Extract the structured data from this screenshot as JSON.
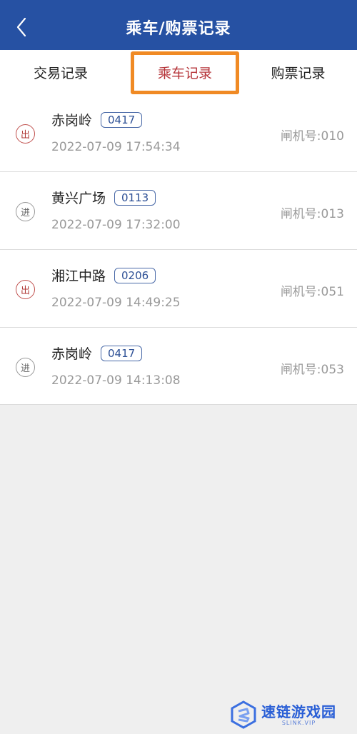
{
  "header": {
    "title": "乘车/购票记录",
    "back_icon": "chevron-left-icon"
  },
  "tabs": [
    {
      "label": "交易记录",
      "active": false
    },
    {
      "label": "乘车记录",
      "active": true
    },
    {
      "label": "购票记录",
      "active": false
    }
  ],
  "records": [
    {
      "direction": "出",
      "type": "exit",
      "station": "赤岗岭",
      "code": "0417",
      "time": "2022-07-09 17:54:34",
      "gate": "闸机号:010"
    },
    {
      "direction": "进",
      "type": "entry",
      "station": "黄兴广场",
      "code": "0113",
      "time": "2022-07-09 17:32:00",
      "gate": "闸机号:013"
    },
    {
      "direction": "出",
      "type": "exit",
      "station": "湘江中路",
      "code": "0206",
      "time": "2022-07-09 14:49:25",
      "gate": "闸机号:051"
    },
    {
      "direction": "进",
      "type": "entry",
      "station": "赤岗岭",
      "code": "0417",
      "time": "2022-07-09 14:13:08",
      "gate": "闸机号:053"
    }
  ],
  "watermark": {
    "text": "速链游戏园",
    "sub": "SLINK.VIP"
  },
  "colors": {
    "header_bg": "#2651a3",
    "active_tab": "#b6363b",
    "highlight_box": "#f08a24"
  }
}
